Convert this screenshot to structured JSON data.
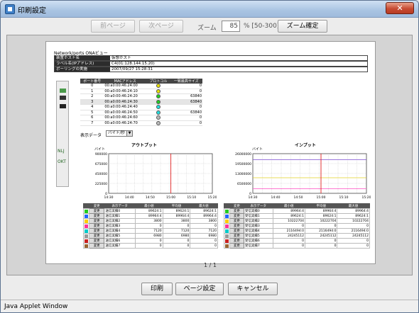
{
  "window": {
    "title": "印刷設定",
    "close_label": "✕"
  },
  "toolbar": {
    "prev_label": "前ページ",
    "next_label": "次ページ",
    "zoom_label": "ズーム",
    "zoom_value": "85",
    "zoom_range": "% [50-300]",
    "zoom_apply_label": "ズーム確定"
  },
  "report": {
    "title": "Network/ports ONAビュー",
    "info": [
      {
        "key": "装置ホスト名",
        "value": "仮想ホスト"
      },
      {
        "key": "ラベル名(IPアドレス)",
        "value": "C4(01:128.144.15.20)"
      },
      {
        "key": "ポーリングの実施",
        "value": "2007/09/27 15:28:31"
      }
    ],
    "device_labels": {
      "top": "NLJ",
      "bottom": "OKT"
    },
    "port_table": {
      "headers": [
        "ポート番号",
        "MACアドレス",
        "プロトコル",
        "一致最高サイズ"
      ],
      "rows": [
        {
          "port": "0",
          "mac": "00:a0:00:46:24:00",
          "status": "yellow",
          "size": "0"
        },
        {
          "port": "1",
          "mac": "00:a0:00:46:24:10",
          "status": "yellow",
          "size": "0"
        },
        {
          "port": "2",
          "mac": "00:a0:00:46:24:20",
          "status": "green",
          "size": "63840"
        },
        {
          "port": "3",
          "mac": "00:a0:00:46:24:30",
          "status": "green",
          "size": "63840"
        },
        {
          "port": "4",
          "mac": "00:a0:00:46:24:40",
          "status": "cyan",
          "size": "0"
        },
        {
          "port": "5",
          "mac": "00:a0:00:46:24:50",
          "status": "cyan",
          "size": "63840"
        },
        {
          "port": "6",
          "mac": "00:a0:00:46:24:60",
          "status": "gray",
          "size": "0"
        },
        {
          "port": "7",
          "mac": "00:a0:00:46:24:70",
          "status": "gray",
          "size": "0"
        }
      ]
    },
    "display_label": "表示データ",
    "display_value": "バイト/秒",
    "page": "1 / 1"
  },
  "chart_data": [
    {
      "type": "line",
      "title": "アウトプット",
      "ylabel": "バイト",
      "x": [
        "14:30",
        "14:40",
        "14:50",
        "15:00",
        "15:10",
        "15:20"
      ],
      "yticks": [
        "900000",
        "675000",
        "450000",
        "225000",
        "0"
      ],
      "ylim": [
        0,
        900000
      ],
      "marker_x": "15:00",
      "series": []
    },
    {
      "type": "line",
      "title": "インプット",
      "ylabel": "バイト",
      "x": [
        "14:30",
        "14:40",
        "14:50",
        "15:00",
        "15:10",
        "15:20"
      ],
      "yticks": [
        "26000000",
        "19500000",
        "13000000",
        "6500000",
        "0"
      ],
      "ylim": [
        0,
        26000000
      ],
      "marker_x": "15:00",
      "series": [
        {
          "color": "#7a4bd0",
          "values": [
            22000000,
            22000000,
            22000000,
            22000000,
            22000000,
            22000000
          ]
        },
        {
          "color": "#e0d020",
          "values": [
            10200000,
            10200000,
            10200000,
            10200000,
            10200000,
            10200000
          ]
        },
        {
          "color": "#ff66cc",
          "values": [
            3000000,
            3000000,
            3000000,
            3000000,
            3000000,
            3000000
          ]
        }
      ]
    }
  ],
  "stat_headers": [
    "",
    "変更",
    "表示データ",
    "最小値",
    "平均値",
    "最大値"
  ],
  "output_stats": [
    {
      "color": "#22cc22",
      "label": "送信実績0",
      "min": "89624:1",
      "avg": "89624:1",
      "max": "89624:1"
    },
    {
      "color": "#2266ff",
      "label": "送信実績1",
      "min": "89964:4",
      "avg": "89964:4",
      "max": "89964:4"
    },
    {
      "color": "#ffcc00",
      "label": "送信実績2",
      "min": "3800",
      "avg": "3800",
      "max": "3800"
    },
    {
      "color": "#ff3399",
      "label": "送信実績3",
      "min": "0",
      "avg": "0",
      "max": "0"
    },
    {
      "color": "#00cccc",
      "label": "送信実績4",
      "min": "7120",
      "avg": "7120",
      "max": "7120"
    },
    {
      "color": "#999999",
      "label": "送信実績5",
      "min": "6980",
      "avg": "6980",
      "max": "6980"
    },
    {
      "color": "#cc2222",
      "label": "送信実績6",
      "min": "0",
      "avg": "0",
      "max": "0"
    },
    {
      "color": "#996633",
      "label": "送信実績7",
      "min": "0",
      "avg": "0",
      "max": "0"
    }
  ],
  "input_stats": [
    {
      "color": "#22cc22",
      "label": "受信実績0",
      "min": "89964:4",
      "avg": "89964:4",
      "max": "89964:4"
    },
    {
      "color": "#2266ff",
      "label": "受信実績1",
      "min": "89624:1",
      "avg": "89624:1",
      "max": "89624:1"
    },
    {
      "color": "#ffcc00",
      "label": "受信実績2",
      "min": "10222704",
      "avg": "10222704",
      "max": "10222704"
    },
    {
      "color": "#ff3399",
      "label": "受信実績3",
      "min": "0",
      "avg": "0",
      "max": "0"
    },
    {
      "color": "#00cccc",
      "label": "受信実績4",
      "min": "2116494:0",
      "avg": "2116494:0",
      "max": "2116494:0"
    },
    {
      "color": "#999999",
      "label": "受信実績5",
      "min": "24245112",
      "avg": "24245112",
      "max": "24245112"
    },
    {
      "color": "#cc2222",
      "label": "受信実績6",
      "min": "0",
      "avg": "0",
      "max": "0"
    },
    {
      "color": "#996633",
      "label": "受信実績7",
      "min": "0",
      "avg": "0",
      "max": "0"
    }
  ],
  "change_label": "変更",
  "footer": {
    "print_label": "印刷",
    "page_setup_label": "ページ設定",
    "cancel_label": "キャンセル"
  },
  "status": {
    "text": "Java Applet Window"
  }
}
